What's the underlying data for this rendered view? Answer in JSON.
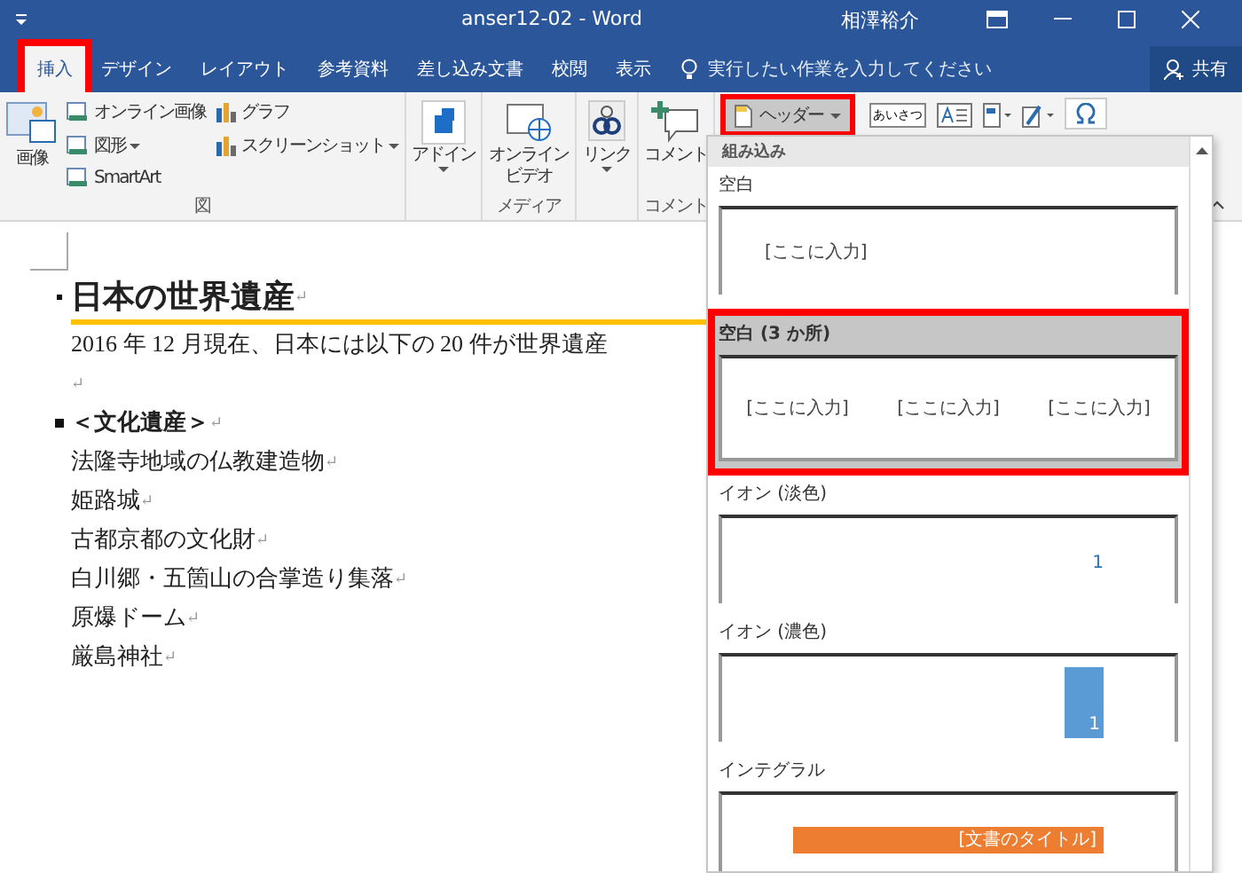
{
  "window": {
    "title": "anser12-02  -  Word",
    "user": "相澤裕介"
  },
  "tabs": [
    {
      "label": "挿入",
      "selected": true,
      "highlighted": true
    },
    {
      "label": "デザイン",
      "selected": false,
      "highlighted": false
    },
    {
      "label": "レイアウト",
      "selected": false,
      "highlighted": false
    },
    {
      "label": "参考資料",
      "selected": false,
      "highlighted": false
    },
    {
      "label": "差し込み文書",
      "selected": false,
      "highlighted": false
    },
    {
      "label": "校閲",
      "selected": false,
      "highlighted": false
    },
    {
      "label": "表示",
      "selected": false,
      "highlighted": false
    }
  ],
  "tell_me": {
    "placeholder": "実行したい作業を入力してください"
  },
  "share_button": "共有",
  "ribbon": {
    "groups": [
      {
        "label": "図",
        "items": [
          {
            "kind": "large",
            "label": "画像",
            "dropdown": false
          },
          {
            "kind": "small",
            "label": "オンライン画像",
            "dropdown": false
          },
          {
            "kind": "small",
            "label": "図形",
            "dropdown": true
          },
          {
            "kind": "small",
            "label": "SmartArt",
            "dropdown": false
          },
          {
            "kind": "small",
            "label": "グラフ",
            "dropdown": false
          },
          {
            "kind": "small",
            "label": "スクリーンショット",
            "dropdown": true
          }
        ]
      },
      {
        "items": [
          {
            "kind": "large",
            "label": "アドイン",
            "dropdown": true
          }
        ]
      },
      {
        "label": "メディア",
        "items": [
          {
            "kind": "large",
            "label": "オンラインビデオ",
            "dropdown": false
          }
        ]
      },
      {
        "items": [
          {
            "kind": "large",
            "label": "リンク",
            "dropdown": true
          }
        ]
      },
      {
        "label": "コメント",
        "items": [
          {
            "kind": "large",
            "label": "コメント",
            "dropdown": false
          }
        ]
      },
      {
        "items": [
          {
            "kind": "header",
            "label": "ヘッダー",
            "dropdown": true,
            "highlighted": true
          }
        ]
      }
    ],
    "greeting_icon_text": "あいさつ"
  },
  "gallery": {
    "section": "組み込み",
    "items": [
      {
        "label": "空白",
        "kind": "blank",
        "selected": false,
        "highlighted": false,
        "texts": [
          "[ここに入力]"
        ]
      },
      {
        "label": "空白 (3 か所)",
        "kind": "blank3",
        "selected": true,
        "highlighted": true,
        "texts": [
          "[ここに入力]",
          "[ここに入力]",
          "[ここに入力]"
        ]
      },
      {
        "label": "イオン (淡色)",
        "kind": "ion_light",
        "selected": false,
        "highlighted": false,
        "texts": [
          "1"
        ]
      },
      {
        "label": "イオン (濃色)",
        "kind": "ion_dark",
        "selected": false,
        "highlighted": false,
        "texts": [
          "1"
        ]
      },
      {
        "label": "インテグラル",
        "kind": "integral",
        "selected": false,
        "highlighted": false,
        "texts": [
          "[文書のタイトル]"
        ]
      }
    ]
  },
  "document": {
    "heading": "日本の世界遺産",
    "heading_mark": "↵",
    "lines": [
      {
        "kind": "text",
        "text": "2016 年 12 月現在、日本には以下の 20 件が世界遺産"
      },
      {
        "kind": "empty",
        "mark": "↵"
      },
      {
        "kind": "bullet",
        "text": "＜文化遺産＞",
        "mark": "↵"
      },
      {
        "kind": "text",
        "text": "法隆寺地域の仏教建造物",
        "mark": "↵"
      },
      {
        "kind": "text",
        "text": "姫路城",
        "mark": "↵"
      },
      {
        "kind": "text",
        "text": "古都京都の文化財",
        "mark": "↵"
      },
      {
        "kind": "text",
        "text": "白川郷・五箇山の合掌造り集落",
        "mark": "↵"
      },
      {
        "kind": "text",
        "text": "原爆ドーム",
        "mark": "↵"
      },
      {
        "kind": "text",
        "text": "厳島神社",
        "mark": "↵"
      }
    ]
  }
}
